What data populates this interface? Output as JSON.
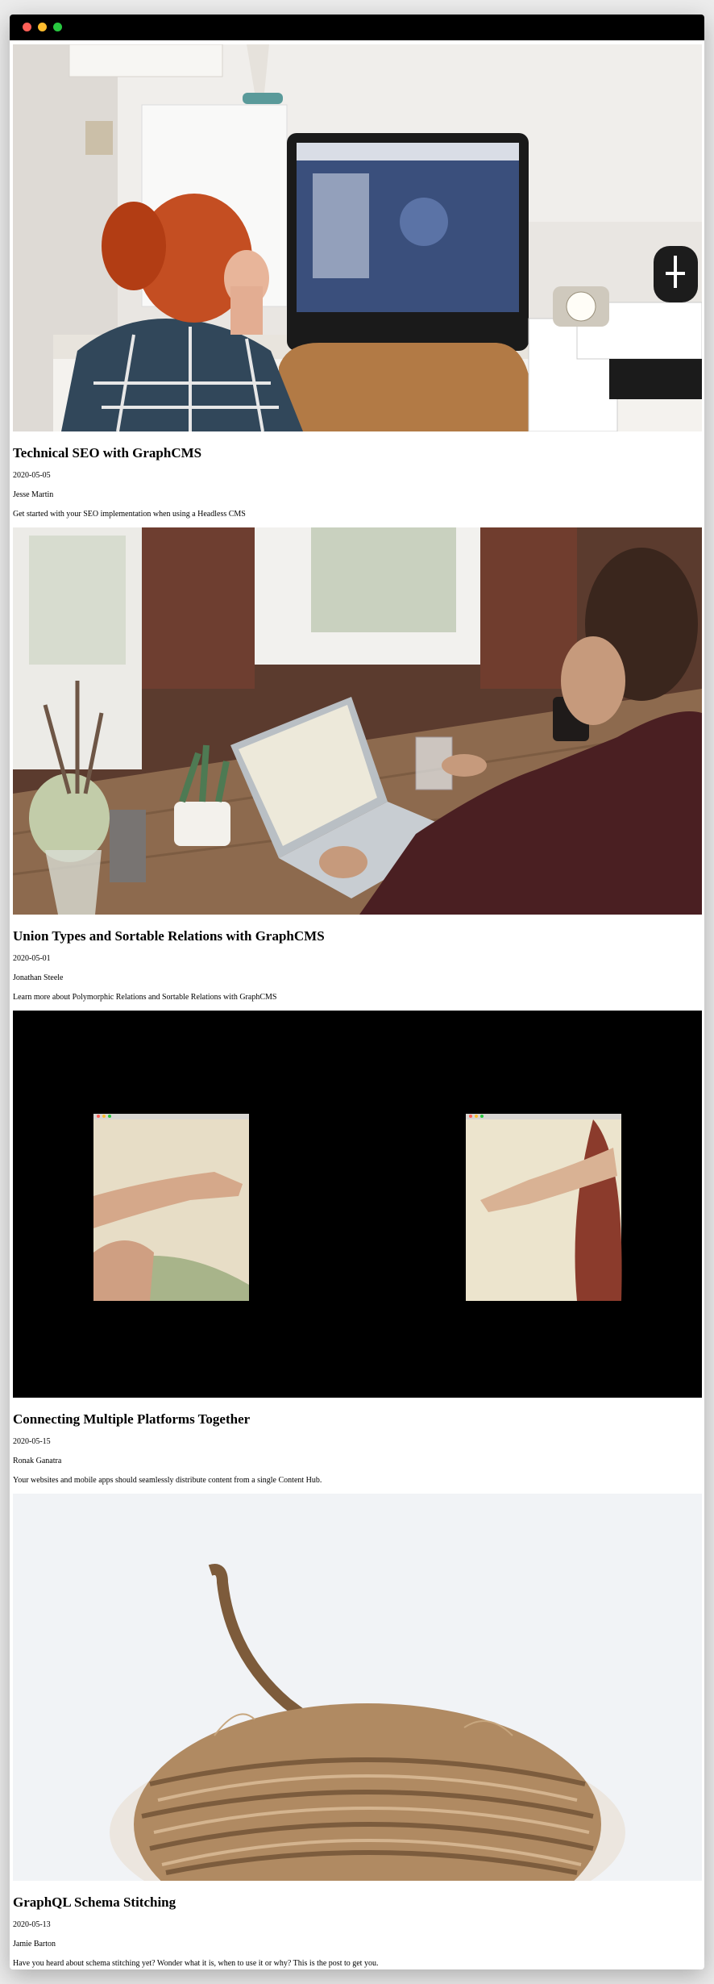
{
  "window": {
    "controls": [
      "close",
      "minimize",
      "zoom"
    ]
  },
  "colors": {
    "titlebar": "#000000",
    "close": "#fe5f57",
    "minimize": "#febc2e",
    "zoom": "#28c840"
  },
  "posts": [
    {
      "title": "Technical SEO with GraphCMS",
      "date": "2020-05-05",
      "author": "Jesse Martin",
      "excerpt": "Get started with your SEO implementation when using a Headless CMS",
      "image": "woman-at-desktop-computer"
    },
    {
      "title": "Union Types and Sortable Relations with GraphCMS",
      "date": "2020-05-01",
      "author": "Jonathan Steele",
      "excerpt": "Learn more about Polymorphic Relations and Sortable Relations with GraphCMS",
      "image": "man-at-laptop"
    },
    {
      "title": "Connecting Multiple Platforms Together",
      "date": "2020-05-15",
      "author": "Ronak Ganatra",
      "excerpt": "Your websites and mobile apps should seamlessly distribute content from a single Content Hub.",
      "image": "creation-of-adam-windows"
    },
    {
      "title": "GraphQL Schema Stitching",
      "date": "2020-05-13",
      "author": "Jamie Barton",
      "excerpt": "Have you heard about schema stitching yet? Wonder what it is, when to use it or why? This is the post to get you.",
      "image": "ball-of-twine"
    }
  ]
}
